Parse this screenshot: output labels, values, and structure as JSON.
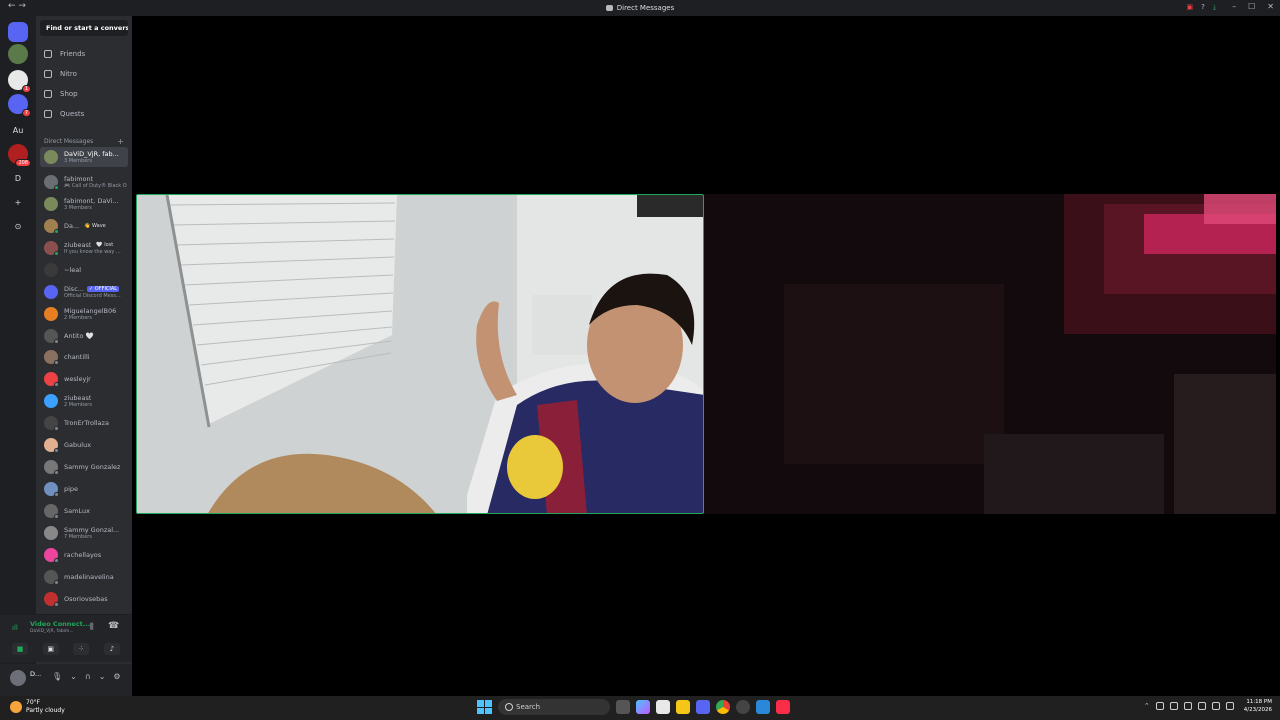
{
  "window": {
    "title": "Direct Messages",
    "nav_arrows": "← →"
  },
  "guilds": [
    {
      "name": "home",
      "label": "",
      "badge": ""
    },
    {
      "name": "server-a",
      "label": "",
      "badge": ""
    },
    {
      "name": "server-b",
      "label": "",
      "badge": "1"
    },
    {
      "name": "server-c",
      "label": "",
      "badge": "7"
    },
    {
      "name": "server-au",
      "label": "Au",
      "badge": ""
    },
    {
      "name": "server-e",
      "label": "",
      "badge": "208"
    },
    {
      "name": "server-d",
      "label": "D",
      "badge": ""
    },
    {
      "name": "add-server",
      "label": "+",
      "badge": ""
    },
    {
      "name": "discover",
      "label": "⊙",
      "badge": ""
    }
  ],
  "sidebar": {
    "search_placeholder": "Find or start a convers...",
    "nav": [
      {
        "label": "Friends"
      },
      {
        "label": "Nitro"
      },
      {
        "label": "Shop"
      },
      {
        "label": "Quests"
      }
    ],
    "dm_header": "Direct Messages",
    "dm_add": "+",
    "dms": [
      {
        "name": "DaViD_VjR, fab...",
        "sub": "3 Members",
        "color": "#7a8a5a",
        "status": "",
        "tag": "",
        "active": true
      },
      {
        "name": "fabimont",
        "sub": "🎮 Call of Duty® Black O",
        "color": "#6b6e73",
        "status": "#23a55a",
        "tag": ""
      },
      {
        "name": "fabimont, DaVi...",
        "sub": "3 Members",
        "color": "#7a8a5a",
        "status": "",
        "tag": ""
      },
      {
        "name": "Da...",
        "sub": "",
        "color": "#a08050",
        "status": "#23a55a",
        "tag": "👋 Wave"
      },
      {
        "name": "ziubeast",
        "sub": "If you know the way ...",
        "color": "#8a5050",
        "status": "#23a55a",
        "tag": "🤍 lost"
      },
      {
        "name": "~leal",
        "sub": "",
        "color": "#3a3a3a",
        "status": "",
        "tag": ""
      },
      {
        "name": "Disc...",
        "sub": "Official Discord Mess...",
        "color": "#5865f2",
        "status": "",
        "tag": "✓ OFFICIAL"
      },
      {
        "name": "MiguelangelB06",
        "sub": "2 Members",
        "color": "#e67e22",
        "status": "",
        "tag": ""
      },
      {
        "name": "Antito 🤍",
        "sub": "",
        "color": "#555",
        "status": "#80848e",
        "tag": ""
      },
      {
        "name": "chantilli",
        "sub": "",
        "color": "#8a7060",
        "status": "#80848e",
        "tag": ""
      },
      {
        "name": "wesleyjr",
        "sub": "",
        "color": "#ed4245",
        "status": "#80848e",
        "tag": ""
      },
      {
        "name": "ziubeast",
        "sub": "2 Members",
        "color": "#3ba0ff",
        "status": "",
        "tag": ""
      },
      {
        "name": "TronErTrollaza",
        "sub": "",
        "color": "#444",
        "status": "#80848e",
        "tag": ""
      },
      {
        "name": "Gabulux",
        "sub": "",
        "color": "#e0b090",
        "status": "#80848e",
        "tag": ""
      },
      {
        "name": "Sammy Gonzalez",
        "sub": "",
        "color": "#777",
        "status": "#80848e",
        "tag": ""
      },
      {
        "name": "pipe",
        "sub": "",
        "color": "#7090c0",
        "status": "#80848e",
        "tag": ""
      },
      {
        "name": "SamLux",
        "sub": "",
        "color": "#666",
        "status": "#80848e",
        "tag": ""
      },
      {
        "name": "Sammy Gonzal...",
        "sub": "7 Members",
        "color": "#888",
        "status": "",
        "tag": ""
      },
      {
        "name": "rachellayos",
        "sub": "",
        "color": "#eb459e",
        "status": "#80848e",
        "tag": ""
      },
      {
        "name": "madelinavelina",
        "sub": "",
        "color": "#555",
        "status": "#80848e",
        "tag": ""
      },
      {
        "name": "Osoriovsebas",
        "sub": "",
        "color": "#c03030",
        "status": "#80848e",
        "tag": ""
      }
    ]
  },
  "voice": {
    "status": "Video Connect...",
    "channel": "DaViD_VjR, fabim..."
  },
  "user": {
    "name": "D..."
  },
  "taskbar": {
    "temp": "70°F",
    "condition": "Partly cloudy",
    "search": "Search",
    "time": "11:18 PM",
    "date": "4/23/2026"
  },
  "colors": {
    "accent": "#5865f2",
    "connected": "#23a55a",
    "speaking_border": "#23a55a"
  }
}
